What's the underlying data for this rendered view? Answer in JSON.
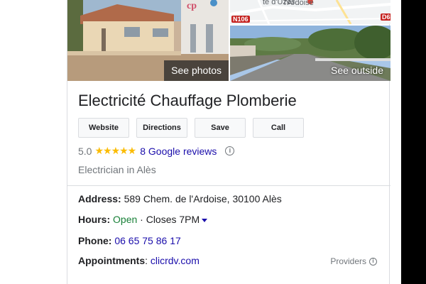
{
  "photos": {
    "left_label": "See photos",
    "right_label": "See outside",
    "map": {
      "label_uzes": "te d'Uzès",
      "label_ardoise": "l'Ardoise",
      "road_n106": "N106",
      "road_d6": "D6"
    }
  },
  "business": {
    "name": "Electricité Chauffage Plomberie",
    "rating": "5.0",
    "stars": "★★★★★",
    "reviews_label": "8 Google reviews",
    "category": "Electrician in Alès"
  },
  "actions": {
    "website": "Website",
    "directions": "Directions",
    "save": "Save",
    "call": "Call"
  },
  "details": {
    "address_label": "Address:",
    "address_value": "589 Chem. de l'Ardoise, 30100 Alès",
    "hours_label": "Hours:",
    "hours_status": "Open",
    "hours_detail": "· Closes 7PM",
    "phone_label": "Phone:",
    "phone_value": "06 65 75 86 17",
    "appointments_label": "Appointments",
    "appointments_value": "clicrdv.com",
    "providers_label": "Providers"
  },
  "colors": {
    "link": "#1a0dab",
    "open": "#188038",
    "star": "#fbbc04",
    "muted": "#70757a"
  }
}
